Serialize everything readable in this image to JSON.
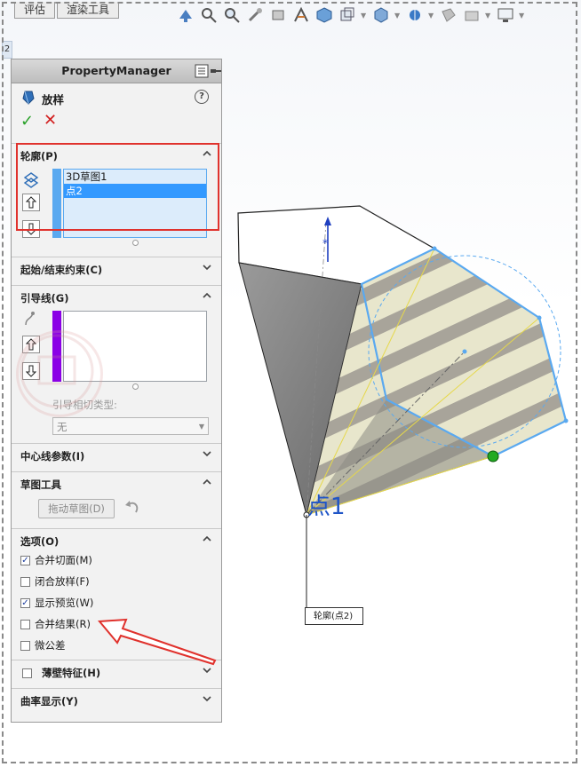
{
  "tabs": [
    "评估",
    "渲染工具"
  ],
  "corner_tag": "2",
  "property_manager": {
    "title": "PropertyManager",
    "feature_title": "放样",
    "help_label": "?",
    "ok_symbol": "✓",
    "cancel_symbol": "✕"
  },
  "profiles": {
    "header": "轮廓(P)",
    "items": [
      {
        "label": "3D草图1",
        "selected": false
      },
      {
        "label": "点2",
        "selected": true
      }
    ]
  },
  "start_end_constraints": {
    "header": "起始/结束约束(C)"
  },
  "guide_curves": {
    "header": "引导线(G)",
    "tangency_label": "引导相切类型:",
    "tangency_value": "无"
  },
  "centerline": {
    "header": "中心线参数(I)"
  },
  "sketch_tools": {
    "header": "草图工具",
    "drag_sketch_label": "拖动草图(D)"
  },
  "options": {
    "header": "选项(O)",
    "items": [
      {
        "label": "合并切面(M)",
        "checked": true
      },
      {
        "label": "闭合放样(F)",
        "checked": false
      },
      {
        "label": "显示预览(W)",
        "checked": true
      },
      {
        "label": "合并结果(R)",
        "checked": false
      },
      {
        "label": "微公差",
        "checked": false
      }
    ]
  },
  "thin_feature": {
    "header": "薄壁特征(H)",
    "checked": false
  },
  "curvature_display": {
    "header": "曲率显示(Y)"
  },
  "viewport": {
    "point_label": "点1",
    "callout_label": "轮廓(点2)"
  },
  "colors": {
    "annotation_red": "#e0322d",
    "selection_blue": "#3399ff",
    "guide_purple": "#8a00e6",
    "profile_blue": "#5aa9f0",
    "point_green": "#22aa22"
  }
}
